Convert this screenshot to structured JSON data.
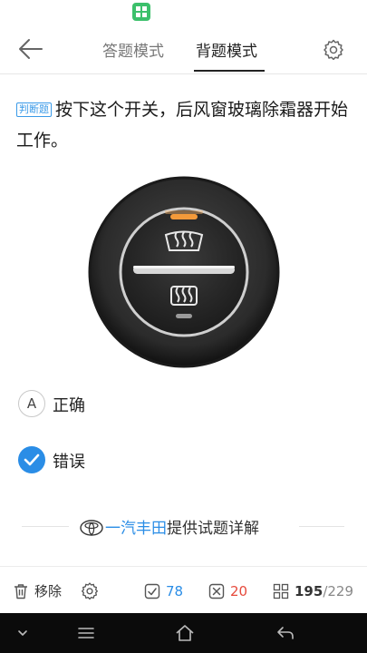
{
  "header": {
    "tabs": [
      {
        "label": "答题模式"
      },
      {
        "label": "背题模式"
      }
    ]
  },
  "question": {
    "badge": "判断题",
    "text": "按下这个开关，后风窗玻璃除霜器开始工作。"
  },
  "options": [
    {
      "letter": "A",
      "text": "正确",
      "selected": false
    },
    {
      "letter": "B",
      "text": "错误",
      "selected": true
    }
  ],
  "explanation": {
    "brand": "一汽丰田",
    "text": "提供试题详解"
  },
  "toolbar": {
    "remove_label": "移除",
    "correct_count": "78",
    "wrong_count": "20",
    "progress_current": "195",
    "progress_total": "/229"
  },
  "colors": {
    "accent": "#2a8de6",
    "wrong": "#e64a3c",
    "status_app": "#3cc06b"
  },
  "icons": [
    "back-arrow-icon",
    "gear-icon",
    "trash-icon",
    "check-box-icon",
    "x-box-icon",
    "grid-icon",
    "defrost-icon",
    "toyota-logo"
  ]
}
